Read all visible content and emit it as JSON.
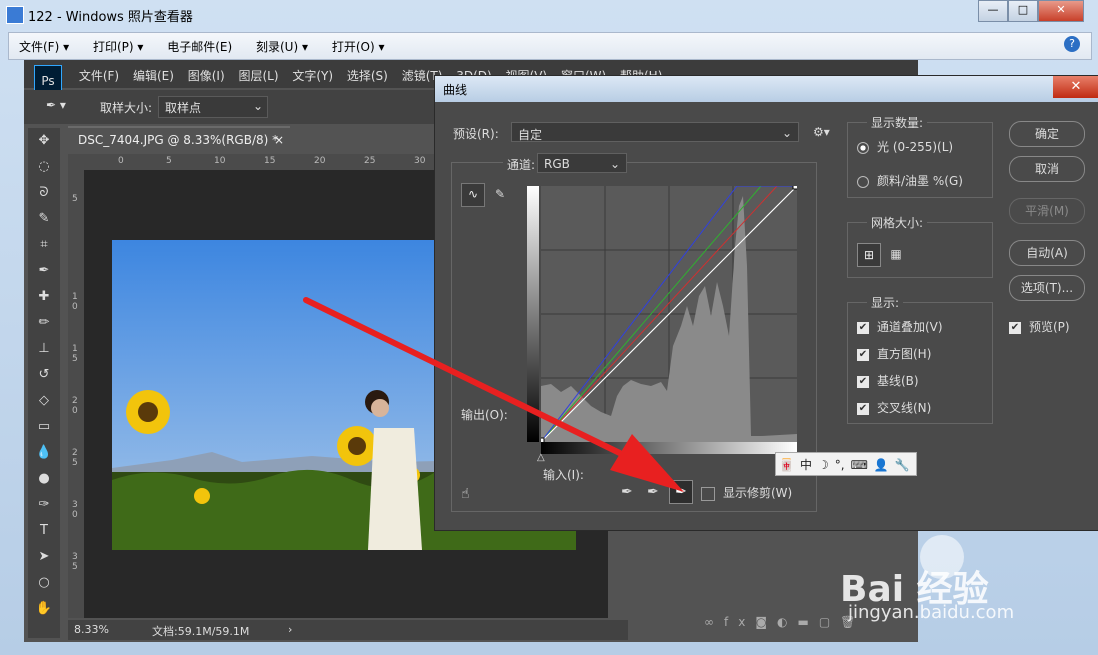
{
  "viewer": {
    "title": "122 - Windows 照片查看器",
    "min": "—",
    "max": "□",
    "close": "✕",
    "menus": [
      "文件(F) ▾",
      "打印(P) ▾",
      "电子邮件(E)",
      "刻录(U) ▾",
      "打开(O) ▾"
    ],
    "help": "?"
  },
  "ps": {
    "logo": "Ps",
    "menus": [
      "文件(F)",
      "编辑(E)",
      "图像(I)",
      "图层(L)",
      "文字(Y)",
      "选择(S)",
      "滤镜(T)",
      "3D(D)",
      "视图(V)",
      "窗口(W)",
      "帮助(H)"
    ],
    "sample_size_label": "取样大小:",
    "sample_size_value": "取样点",
    "doc_tab": "DSC_7404.JPG @ 8.33%(RGB/8) *",
    "zoom": "8.33%",
    "doc_info": "文档:59.1M/59.1M",
    "ruler_h": [
      "0",
      "5",
      "10",
      "15",
      "20",
      "25",
      "30"
    ],
    "ruler_v": [
      "5",
      "1 0",
      "1 5",
      "2 0",
      "2 5",
      "3 0",
      "3 5"
    ]
  },
  "curves": {
    "title": "曲线",
    "close": "✕",
    "preset_label": "预设(R):",
    "preset_value": "自定",
    "channel_label": "通道:",
    "channel_value": "RGB",
    "output_label": "输出(O):",
    "input_label": "输入(I):",
    "show_clipping": "显示修剪(W)",
    "display_amount_title": "显示数量:",
    "light_option": "光 (0-255)(L)",
    "pigment_option": "颜料/油墨 %(G)",
    "grid_size_title": "网格大小:",
    "show_title": "显示:",
    "show_options": [
      "通道叠加(V)",
      "直方图(H)",
      "基线(B)",
      "交叉线(N)"
    ],
    "buttons": {
      "ok": "确定",
      "cancel": "取消",
      "smooth": "平滑(M)",
      "auto": "自动(A)",
      "options": "选项(T)..."
    },
    "preview": "预览(P)",
    "curve_colors": {
      "rgb": "#ffffff",
      "red": "#d03030",
      "green": "#30b030",
      "blue": "#3040e0"
    }
  },
  "ime": {
    "items": [
      "🀄",
      "中",
      "☽",
      "°,",
      "⌨",
      "👤",
      "🔧"
    ]
  },
  "watermark": {
    "brand": "Bai 经验",
    "url": "jingyan.baidu.com"
  },
  "arrow_color": "#e82020"
}
